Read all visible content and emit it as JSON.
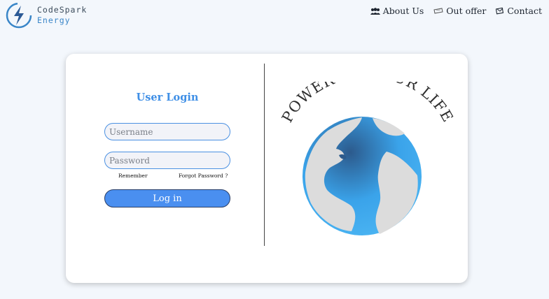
{
  "brand": {
    "line1": "CodeSpark",
    "line2": "Energy"
  },
  "nav": [
    {
      "label": "About Us",
      "icon": "users-icon"
    },
    {
      "label": "Out offer",
      "icon": "ticket-icon"
    },
    {
      "label": "Contact",
      "icon": "contact-icon"
    }
  ],
  "login": {
    "title": "User Login",
    "username_placeholder": "Username",
    "password_placeholder": "Password",
    "remember_label": "Remember",
    "forgot_label": "Forgot Password ?",
    "button_label": "Log in"
  },
  "hero": {
    "slogan": "POWER UP YOUR LIFE"
  },
  "colors": {
    "accent": "#4a8ff0",
    "title": "#3f8fe6",
    "background": "#f3f7fc",
    "ocean": "#3aa3ea",
    "land": "#dcdcdc"
  }
}
